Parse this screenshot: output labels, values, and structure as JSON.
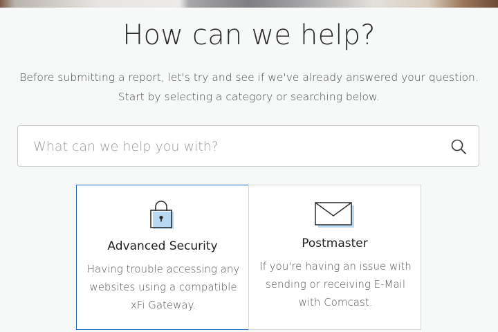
{
  "header": {
    "title": "How can we help?",
    "subtitle_line1": "Before submitting a report, let's try and see if we've already answered your question.",
    "subtitle_line2": "Start by selecting a category or searching below."
  },
  "search": {
    "placeholder": "What can we help you with?",
    "value": "",
    "icon": "search-icon"
  },
  "categories": [
    {
      "title": "Advanced Security",
      "description": "Having trouble accessing any websites using a compatible xFi Gateway.",
      "icon": "padlock-icon",
      "selected": true
    },
    {
      "title": "Postmaster",
      "description": "If you're having an issue with sending or receiving E-Mail with Comcast.",
      "icon": "envelope-icon",
      "selected": false
    }
  ],
  "colors": {
    "background": "#f7f9f9",
    "card_border": "#d4d6d8",
    "selected_border": "#1f69c9",
    "icon_accent": "#b9d8f2"
  }
}
